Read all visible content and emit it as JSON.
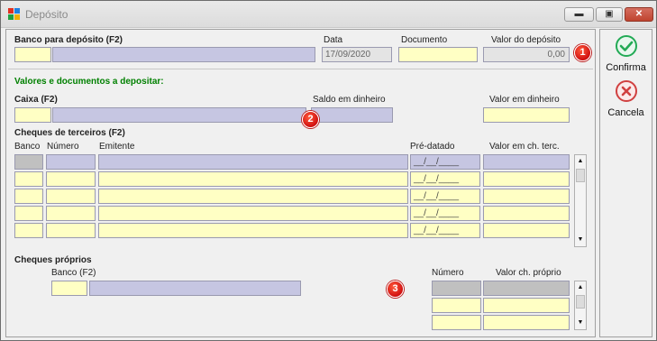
{
  "window": {
    "title": "Depósito",
    "min_glyph": "▬",
    "max_glyph": "▣",
    "close_glyph": "✕"
  },
  "header": {
    "banco_label": "Banco para depósito (F2)",
    "data_label": "Data",
    "data_value": "17/09/2020",
    "documento_label": "Documento",
    "valor_label": "Valor do depósito",
    "valor_value": "0,00",
    "badge": "1"
  },
  "valores": {
    "section_title": "Valores e documentos a depositar:",
    "caixa_label": "Caixa (F2)",
    "saldo_label": "Saldo em dinheiro",
    "valor_dinheiro_label": "Valor em dinheiro",
    "badge": "2"
  },
  "cheques_terceiros": {
    "title": "Cheques de terceiros (F2)",
    "columns": [
      "Banco",
      "Número",
      "Emitente",
      "Pré-datado",
      "Valor em ch. terc."
    ],
    "date_mask": "__/__/____",
    "rows": 5
  },
  "cheques_proprios": {
    "title": "Cheques próprios",
    "banco_label": "Banco (F2)",
    "numero_label": "Número",
    "valor_label": "Valor ch. próprio",
    "badge": "3"
  },
  "actions": {
    "confirma": "Confirma",
    "cancela": "Cancela"
  },
  "colors": {
    "lavender": "#c6c6e2",
    "yellow": "#ffffc4",
    "green_title": "#008000",
    "badge_red": "#d01010"
  }
}
